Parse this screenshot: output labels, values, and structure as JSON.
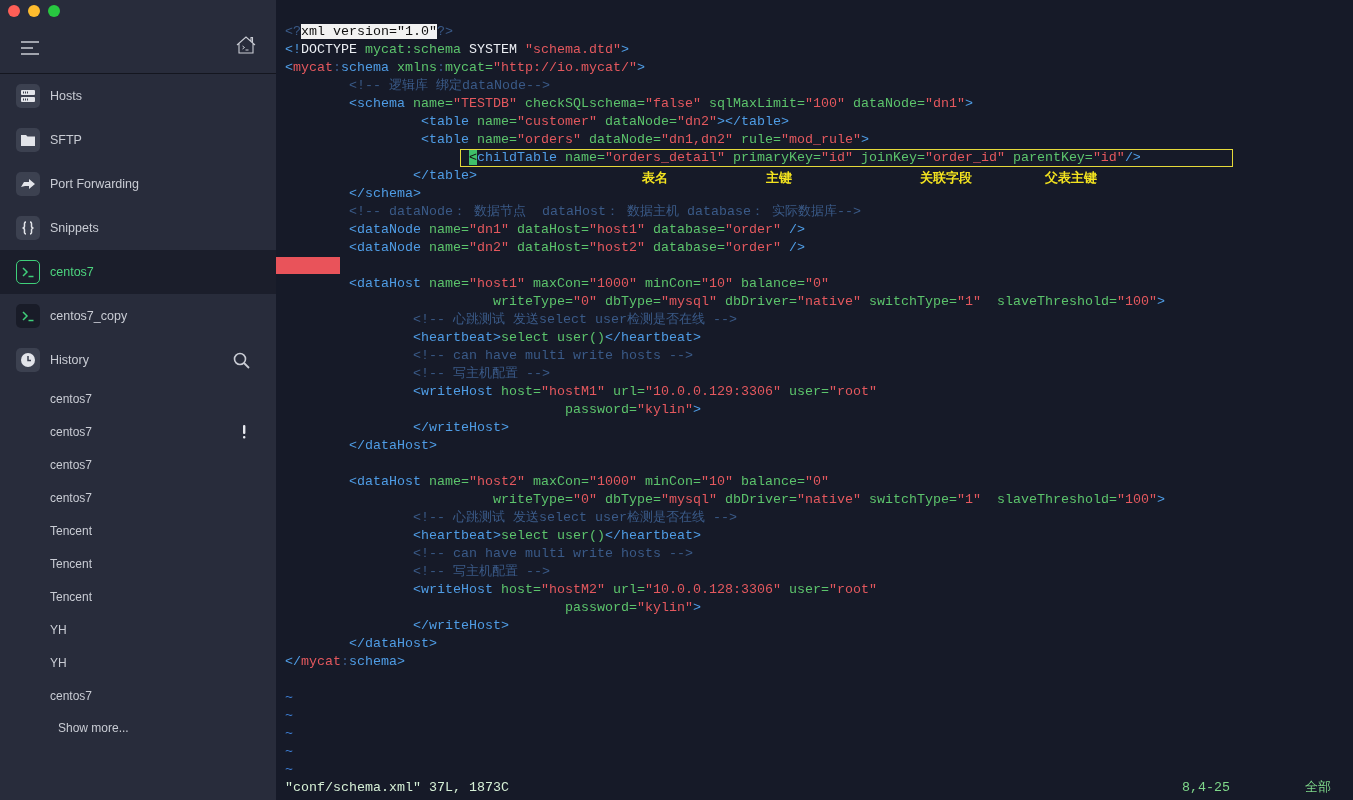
{
  "sidebar": {
    "nav": [
      {
        "label": "Hosts",
        "kind": "hosts",
        "selected": false
      },
      {
        "label": "SFTP",
        "kind": "folder",
        "selected": false
      },
      {
        "label": "Port Forwarding",
        "kind": "forward",
        "selected": false
      },
      {
        "label": "Snippets",
        "kind": "braces",
        "selected": false
      },
      {
        "label": "centos7",
        "kind": "terminal",
        "selected": true
      },
      {
        "label": "centos7_copy",
        "kind": "terminal",
        "selected": false
      }
    ],
    "history": {
      "label": "History"
    },
    "history_items": [
      {
        "label": "centos7",
        "warning": false
      },
      {
        "label": "centos7",
        "warning": true
      },
      {
        "label": "centos7",
        "warning": false
      },
      {
        "label": "centos7",
        "warning": false
      },
      {
        "label": "Tencent",
        "warning": false
      },
      {
        "label": "Tencent",
        "warning": false
      },
      {
        "label": "Tencent",
        "warning": false
      },
      {
        "label": "YH",
        "warning": false
      },
      {
        "label": "YH",
        "warning": false
      },
      {
        "label": "centos7",
        "warning": false
      }
    ],
    "show_more": "Show more..."
  },
  "editor": {
    "lines": [
      {
        "kind": "code",
        "tokens": [
          {
            "kind": "comment",
            "text": "<?"
          },
          {
            "kind": "select",
            "text": "xml version=\"1.0\""
          },
          {
            "kind": "comment",
            "text": "?>"
          }
        ]
      },
      {
        "kind": "code",
        "tokens": [
          {
            "kind": "tag",
            "text": "<!"
          },
          {
            "kind": "plain",
            "text": "DOCTYPE"
          },
          {
            "kind": "attr",
            "text": " mycat:schema"
          },
          {
            "kind": "plain",
            "text": " SYSTEM"
          },
          {
            "kind": "value",
            "text": " \"schema.dtd\""
          },
          {
            "kind": "tag",
            "text": ">"
          }
        ]
      },
      {
        "kind": "code",
        "tokens": [
          {
            "kind": "tag",
            "text": "<"
          },
          {
            "kind": "ns",
            "text": "mycat"
          },
          {
            "kind": "colon",
            "text": ":"
          },
          {
            "kind": "tag",
            "text": "schema"
          },
          {
            "kind": "attr",
            "text": " xmlns"
          },
          {
            "kind": "colon",
            "text": ":"
          },
          {
            "kind": "attr",
            "text": "mycat="
          },
          {
            "kind": "value",
            "text": "\"http://io.mycat/\""
          },
          {
            "kind": "tag",
            "text": ">"
          }
        ]
      },
      {
        "kind": "code",
        "tokens": [
          {
            "kind": "comment",
            "text": "        <!-- 逻辑库 绑定dataNode-->"
          }
        ]
      },
      {
        "kind": "code",
        "tokens": [
          {
            "kind": "tag",
            "text": "        <schema"
          },
          {
            "kind": "attr",
            "text": " name="
          },
          {
            "kind": "value",
            "text": "\"TESTDB\""
          },
          {
            "kind": "attr",
            "text": " checkSQLschema="
          },
          {
            "kind": "value",
            "text": "\"false\""
          },
          {
            "kind": "attr",
            "text": " sqlMaxLimit="
          },
          {
            "kind": "value",
            "text": "\"100\""
          },
          {
            "kind": "attr",
            "text": " dataNode="
          },
          {
            "kind": "value",
            "text": "\"dn1\""
          },
          {
            "kind": "tag",
            "text": ">"
          }
        ]
      },
      {
        "kind": "code",
        "tokens": [
          {
            "kind": "tag",
            "text": "                 <table"
          },
          {
            "kind": "attr",
            "text": " name="
          },
          {
            "kind": "value",
            "text": "\"customer\""
          },
          {
            "kind": "attr",
            "text": " dataNode="
          },
          {
            "kind": "value",
            "text": "\"dn2\""
          },
          {
            "kind": "tag",
            "text": "></table>"
          }
        ]
      },
      {
        "kind": "code",
        "tokens": [
          {
            "kind": "tag",
            "text": "                 <table"
          },
          {
            "kind": "attr",
            "text": " name="
          },
          {
            "kind": "value",
            "text": "\"orders\""
          },
          {
            "kind": "attr",
            "text": " dataNode="
          },
          {
            "kind": "value",
            "text": "\"dn1,dn2\""
          },
          {
            "kind": "attr",
            "text": " rule="
          },
          {
            "kind": "value",
            "text": "\"mod_rule\""
          },
          {
            "kind": "tag",
            "text": ">"
          }
        ]
      },
      {
        "kind": "code",
        "boxed": true,
        "tokens": [
          {
            "kind": "cursor",
            "text": "                       <"
          },
          {
            "kind": "tag",
            "text": "childTable"
          },
          {
            "kind": "attr",
            "text": " name="
          },
          {
            "kind": "value",
            "text": "\"orders_detail\""
          },
          {
            "kind": "attr",
            "text": " primaryKey="
          },
          {
            "kind": "value",
            "text": "\"id\""
          },
          {
            "kind": "attr",
            "text": " joinKey="
          },
          {
            "kind": "value",
            "text": "\"order_id\""
          },
          {
            "kind": "attr",
            "text": " parentKey="
          },
          {
            "kind": "value",
            "text": "\"id\""
          },
          {
            "kind": "tag",
            "text": "/>"
          }
        ]
      },
      {
        "kind": "code",
        "tokens": [
          {
            "kind": "tag",
            "text": "                </table>"
          }
        ],
        "notes": [
          "表名",
          "主键",
          "关联字段",
          "父表主键"
        ]
      },
      {
        "kind": "code",
        "tokens": [
          {
            "kind": "tag",
            "text": "        </schema>"
          }
        ]
      },
      {
        "kind": "code",
        "tokens": [
          {
            "kind": "comment",
            "text": "        <!-- dataNode： 数据节点  dataHost： 数据主机 database： 实际数据库-->"
          }
        ]
      },
      {
        "kind": "code",
        "tokens": [
          {
            "kind": "tag",
            "text": "        <dataNode"
          },
          {
            "kind": "attr",
            "text": " name="
          },
          {
            "kind": "value",
            "text": "\"dn1\""
          },
          {
            "kind": "attr",
            "text": " dataHost="
          },
          {
            "kind": "value",
            "text": "\"host1\""
          },
          {
            "kind": "attr",
            "text": " database="
          },
          {
            "kind": "value",
            "text": "\"order\""
          },
          {
            "kind": "tag",
            "text": " />"
          }
        ]
      },
      {
        "kind": "code",
        "tokens": [
          {
            "kind": "tag",
            "text": "        <dataNode"
          },
          {
            "kind": "attr",
            "text": " name="
          },
          {
            "kind": "value",
            "text": "\"dn2\""
          },
          {
            "kind": "attr",
            "text": " dataHost="
          },
          {
            "kind": "value",
            "text": "\"host2\""
          },
          {
            "kind": "attr",
            "text": " database="
          },
          {
            "kind": "value",
            "text": "\"order\""
          },
          {
            "kind": "tag",
            "text": " />"
          }
        ]
      },
      {
        "kind": "mark"
      },
      {
        "kind": "code",
        "tokens": [
          {
            "kind": "tag",
            "text": "        <dataHost"
          },
          {
            "kind": "attr",
            "text": " name="
          },
          {
            "kind": "value",
            "text": "\"host1\""
          },
          {
            "kind": "attr",
            "text": " maxCon="
          },
          {
            "kind": "value",
            "text": "\"1000\""
          },
          {
            "kind": "attr",
            "text": " minCon="
          },
          {
            "kind": "value",
            "text": "\"10\""
          },
          {
            "kind": "attr",
            "text": " balance="
          },
          {
            "kind": "value",
            "text": "\"0\""
          }
        ]
      },
      {
        "kind": "code",
        "tokens": [
          {
            "kind": "attr",
            "text": "                          writeType="
          },
          {
            "kind": "value",
            "text": "\"0\""
          },
          {
            "kind": "attr",
            "text": " dbType="
          },
          {
            "kind": "value",
            "text": "\"mysql\""
          },
          {
            "kind": "attr",
            "text": " dbDriver="
          },
          {
            "kind": "value",
            "text": "\"native\""
          },
          {
            "kind": "attr",
            "text": " switchType="
          },
          {
            "kind": "value",
            "text": "\"1\""
          },
          {
            "kind": "attr",
            "text": "  slaveThreshold="
          },
          {
            "kind": "value",
            "text": "\"100\""
          },
          {
            "kind": "tag",
            "text": ">"
          }
        ]
      },
      {
        "kind": "code",
        "tokens": [
          {
            "kind": "comment",
            "text": "                <!-- 心跳测试 发送select user检测是否在线 -->"
          }
        ]
      },
      {
        "kind": "code",
        "tokens": [
          {
            "kind": "tag",
            "text": "                <heartbeat>"
          },
          {
            "kind": "body",
            "text": "select user()"
          },
          {
            "kind": "tag",
            "text": "</heartbeat>"
          }
        ]
      },
      {
        "kind": "code",
        "tokens": [
          {
            "kind": "comment",
            "text": "                <!-- can have multi write hosts -->"
          }
        ]
      },
      {
        "kind": "code",
        "tokens": [
          {
            "kind": "comment",
            "text": "                <!-- 写主机配置 -->"
          }
        ]
      },
      {
        "kind": "code",
        "tokens": [
          {
            "kind": "tag",
            "text": "                <writeHost"
          },
          {
            "kind": "attr",
            "text": " host="
          },
          {
            "kind": "value",
            "text": "\"hostM1\""
          },
          {
            "kind": "attr",
            "text": " url="
          },
          {
            "kind": "value",
            "text": "\"10.0.0.129:3306\""
          },
          {
            "kind": "attr",
            "text": " user="
          },
          {
            "kind": "value",
            "text": "\"root\""
          }
        ]
      },
      {
        "kind": "code",
        "tokens": [
          {
            "kind": "attr",
            "text": "                                   password="
          },
          {
            "kind": "value",
            "text": "\"kylin\""
          },
          {
            "kind": "tag",
            "text": ">"
          }
        ]
      },
      {
        "kind": "code",
        "tokens": [
          {
            "kind": "tag",
            "text": "                </writeHost>"
          }
        ]
      },
      {
        "kind": "code",
        "tokens": [
          {
            "kind": "tag",
            "text": "        </dataHost>"
          }
        ]
      },
      {
        "kind": "blank"
      },
      {
        "kind": "code",
        "tokens": [
          {
            "kind": "tag",
            "text": "        <dataHost"
          },
          {
            "kind": "attr",
            "text": " name="
          },
          {
            "kind": "value",
            "text": "\"host2\""
          },
          {
            "kind": "attr",
            "text": " maxCon="
          },
          {
            "kind": "value",
            "text": "\"1000\""
          },
          {
            "kind": "attr",
            "text": " minCon="
          },
          {
            "kind": "value",
            "text": "\"10\""
          },
          {
            "kind": "attr",
            "text": " balance="
          },
          {
            "kind": "value",
            "text": "\"0\""
          }
        ]
      },
      {
        "kind": "code",
        "tokens": [
          {
            "kind": "attr",
            "text": "                          writeType="
          },
          {
            "kind": "value",
            "text": "\"0\""
          },
          {
            "kind": "attr",
            "text": " dbType="
          },
          {
            "kind": "value",
            "text": "\"mysql\""
          },
          {
            "kind": "attr",
            "text": " dbDriver="
          },
          {
            "kind": "value",
            "text": "\"native\""
          },
          {
            "kind": "attr",
            "text": " switchType="
          },
          {
            "kind": "value",
            "text": "\"1\""
          },
          {
            "kind": "attr",
            "text": "  slaveThreshold="
          },
          {
            "kind": "value",
            "text": "\"100\""
          },
          {
            "kind": "tag",
            "text": ">"
          }
        ]
      },
      {
        "kind": "code",
        "tokens": [
          {
            "kind": "comment",
            "text": "                <!-- 心跳测试 发送select user检测是否在线 -->"
          }
        ]
      },
      {
        "kind": "code",
        "tokens": [
          {
            "kind": "tag",
            "text": "                <heartbeat>"
          },
          {
            "kind": "body",
            "text": "select user()"
          },
          {
            "kind": "tag",
            "text": "</heartbeat>"
          }
        ]
      },
      {
        "kind": "code",
        "tokens": [
          {
            "kind": "comment",
            "text": "                <!-- can have multi write hosts -->"
          }
        ]
      },
      {
        "kind": "code",
        "tokens": [
          {
            "kind": "comment",
            "text": "                <!-- 写主机配置 -->"
          }
        ]
      },
      {
        "kind": "code",
        "tokens": [
          {
            "kind": "tag",
            "text": "                <writeHost"
          },
          {
            "kind": "attr",
            "text": " host="
          },
          {
            "kind": "value",
            "text": "\"hostM2\""
          },
          {
            "kind": "attr",
            "text": " url="
          },
          {
            "kind": "value",
            "text": "\"10.0.0.128:3306\""
          },
          {
            "kind": "attr",
            "text": " user="
          },
          {
            "kind": "value",
            "text": "\"root\""
          }
        ]
      },
      {
        "kind": "code",
        "tokens": [
          {
            "kind": "attr",
            "text": "                                   password="
          },
          {
            "kind": "value",
            "text": "\"kylin\""
          },
          {
            "kind": "tag",
            "text": ">"
          }
        ]
      },
      {
        "kind": "code",
        "tokens": [
          {
            "kind": "tag",
            "text": "                </writeHost>"
          }
        ]
      },
      {
        "kind": "code",
        "tokens": [
          {
            "kind": "tag",
            "text": "        </dataHost>"
          }
        ]
      },
      {
        "kind": "code",
        "tokens": [
          {
            "kind": "tag",
            "text": "</"
          },
          {
            "kind": "ns",
            "text": "mycat"
          },
          {
            "kind": "colon",
            "text": ":"
          },
          {
            "kind": "tag",
            "text": "schema>"
          }
        ]
      },
      {
        "kind": "blank"
      },
      {
        "kind": "tilde",
        "text": "~"
      },
      {
        "kind": "tilde",
        "text": "~"
      },
      {
        "kind": "tilde",
        "text": "~"
      },
      {
        "kind": "tilde",
        "text": "~"
      },
      {
        "kind": "tilde",
        "text": "~"
      }
    ],
    "status_bar": {
      "file": "\"conf/schema.xml\" 37L, 1873C",
      "position": "8,4-25",
      "scroll": "全部"
    }
  }
}
